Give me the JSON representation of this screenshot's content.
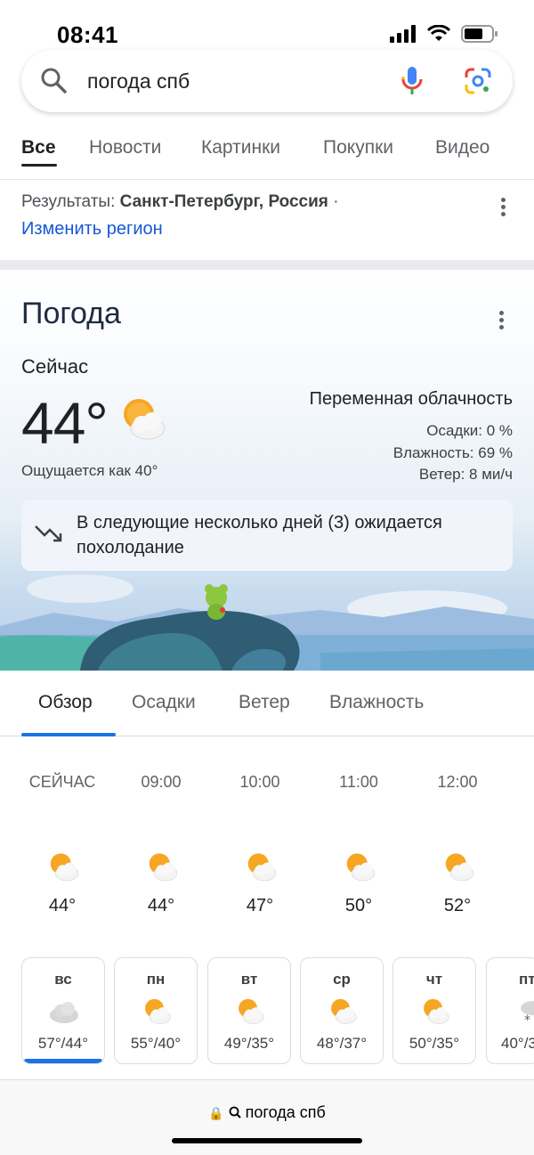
{
  "status": {
    "time": "08:41"
  },
  "search": {
    "query": "погода спб"
  },
  "tabs": [
    "Все",
    "Новости",
    "Картинки",
    "Покупки",
    "Видео"
  ],
  "region": {
    "prefix": "Результаты:",
    "place": "Санкт-Петербург, Россия",
    "sep": "·",
    "change_link": "Изменить регион"
  },
  "weather": {
    "title": "Погода",
    "now_label": "Сейчас",
    "temp": "44°",
    "feels": "Ощущается как 40°",
    "condition": "Переменная облачность",
    "precip": "Осадки: 0 %",
    "humidity": "Влажность: 69 %",
    "wind": "Ветер: 8 ми/ч",
    "alert": "В следующие несколько дней (3) ожидается похолодание"
  },
  "subtabs": [
    "Обзор",
    "Осадки",
    "Ветер",
    "Влажность"
  ],
  "hourly": [
    {
      "time": "СЕЙЧАС",
      "temp": "44°"
    },
    {
      "time": "09:00",
      "temp": "44°"
    },
    {
      "time": "10:00",
      "temp": "47°"
    },
    {
      "time": "11:00",
      "temp": "50°"
    },
    {
      "time": "12:00",
      "temp": "52°"
    }
  ],
  "daily": [
    {
      "day": "вс",
      "temps": "57°/44°",
      "icon": "cloud-icon"
    },
    {
      "day": "пн",
      "temps": "55°/40°",
      "icon": "partly-cloudy-icon"
    },
    {
      "day": "вт",
      "temps": "49°/35°",
      "icon": "partly-cloudy-icon"
    },
    {
      "day": "ср",
      "temps": "48°/37°",
      "icon": "partly-cloudy-icon"
    },
    {
      "day": "чт",
      "temps": "50°/35°",
      "icon": "partly-cloudy-icon"
    },
    {
      "day": "пт",
      "temps": "40°/3",
      "icon": "snow-cloud-icon"
    }
  ],
  "bottom": {
    "url": "погода спб"
  },
  "colors": {
    "accent": "#1a73e8",
    "link": "#1558d6",
    "sun": "#f6a623"
  }
}
